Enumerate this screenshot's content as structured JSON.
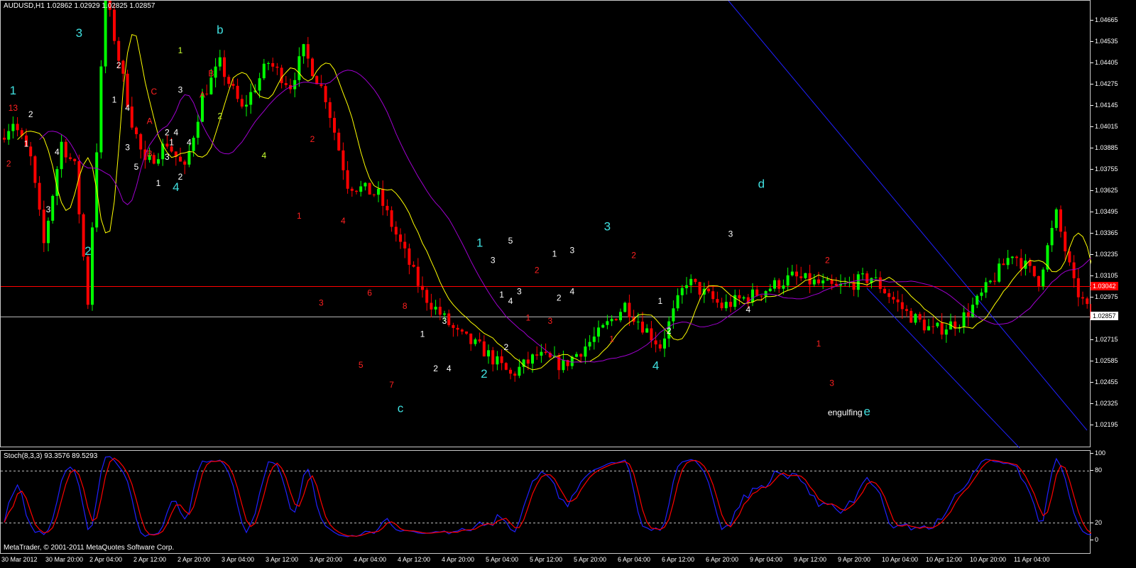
{
  "chart_header": "AUDUSD,H1  1.02862 1.02929 1.02825 1.02857",
  "stoch_header": "Stoch(8,3,3) 93.3576 89.5293",
  "copyright": "MetaTrader, © 2001-2011 MetaQuotes Software Corp.",
  "colors": {
    "bull": "#00ff00",
    "bear": "#ff0000",
    "fast_ma": "#ffff00",
    "slow_ma": "#a000d0",
    "channel": "#2020ff",
    "red_level": "#ff0000",
    "price_line": "#c0c0c0",
    "stoch_main": "#2020ff",
    "stoch_signal": "#ff0000"
  },
  "price_scale": [
    "1.04665",
    "1.04535",
    "1.04405",
    "1.04275",
    "1.04145",
    "1.04015",
    "1.03885",
    "1.03755",
    "1.03625",
    "1.03495",
    "1.03365",
    "1.03235",
    "1.03105",
    "1.02975",
    "1.02845",
    "1.02715",
    "1.02585",
    "1.02455",
    "1.02325",
    "1.02195"
  ],
  "badges": {
    "red_level_value": "1.03042",
    "current_price": "1.02857"
  },
  "stoch_scale": [
    "100",
    "80",
    "20",
    "0"
  ],
  "time_scale": [
    "30 Mar 2012",
    "30 Mar 20:00",
    "2 Apr 04:00",
    "2 Apr 12:00",
    "2 Apr 20:00",
    "3 Apr 04:00",
    "3 Apr 12:00",
    "3 Apr 20:00",
    "4 Apr 04:00",
    "4 Apr 12:00",
    "4 Apr 20:00",
    "5 Apr 04:00",
    "5 Apr 12:00",
    "5 Apr 20:00",
    "6 Apr 04:00",
    "6 Apr 12:00",
    "6 Apr 20:00",
    "9 Apr 04:00",
    "9 Apr 12:00",
    "9 Apr 20:00",
    "10 Apr 04:00",
    "10 Apr 12:00",
    "10 Apr 20:00",
    "11 Apr 04:00"
  ],
  "chart_data": {
    "type": "candlestick",
    "symbol": "AUDUSD",
    "timeframe": "H1",
    "ylim": [
      1.02195,
      1.04665
    ],
    "bar_count": 250,
    "levels": {
      "red_horizontal": 1.03042,
      "current_price": 1.02857
    },
    "waypoints": [
      [
        0,
        1.0395
      ],
      [
        3,
        1.0405
      ],
      [
        7,
        1.0382
      ],
      [
        10,
        1.033
      ],
      [
        14,
        1.0392
      ],
      [
        17,
        1.0377
      ],
      [
        20,
        1.0295
      ],
      [
        24,
        1.0482
      ],
      [
        30,
        1.0405
      ],
      [
        33,
        1.0378
      ],
      [
        38,
        1.0392
      ],
      [
        42,
        1.0375
      ],
      [
        46,
        1.042
      ],
      [
        50,
        1.044
      ],
      [
        55,
        1.0412
      ],
      [
        61,
        1.0441
      ],
      [
        66,
        1.0427
      ],
      [
        69,
        1.0448
      ],
      [
        74,
        1.042
      ],
      [
        79,
        1.0367
      ],
      [
        86,
        1.036
      ],
      [
        96,
        1.03
      ],
      [
        104,
        1.0275
      ],
      [
        110,
        1.0265
      ],
      [
        116,
        1.025
      ],
      [
        122,
        1.0262
      ],
      [
        128,
        1.0256
      ],
      [
        136,
        1.0275
      ],
      [
        142,
        1.0293
      ],
      [
        150,
        1.0268
      ],
      [
        156,
        1.0308
      ],
      [
        164,
        1.0292
      ],
      [
        172,
        1.03
      ],
      [
        180,
        1.031
      ],
      [
        190,
        1.0303
      ],
      [
        198,
        1.031
      ],
      [
        206,
        1.0288
      ],
      [
        212,
        1.0277
      ],
      [
        218,
        1.0283
      ],
      [
        222,
        1.0295
      ],
      [
        230,
        1.0325
      ],
      [
        236,
        1.0308
      ],
      [
        240,
        1.0348
      ],
      [
        244,
        1.0305
      ],
      [
        250,
        1.0275
      ]
    ],
    "price_labels": [
      {
        "text": "3",
        "t": "30 Mar 17:00",
        "price": 1.04565,
        "color": "cyan"
      },
      {
        "text": "b",
        "t": "3 Apr 01:00",
        "price": 1.04585,
        "color": "cyan"
      },
      {
        "text": "1",
        "t": "2 Apr 16:00",
        "price": 1.04465,
        "color": "yellow"
      },
      {
        "text": "1",
        "t": "30 Mar 02:00",
        "price": 1.04215,
        "color": "cyan"
      },
      {
        "text": "13",
        "t": "30 Mar 02:00",
        "price": 1.04115,
        "color": "red"
      },
      {
        "text": "2",
        "t": "30 Mar 06:00",
        "price": 1.04075,
        "color": "white"
      },
      {
        "text": "2",
        "t": "30 Mar 01:00",
        "price": 1.03775,
        "color": "red"
      },
      {
        "text": "1",
        "t": "30 Mar 05:00",
        "price": 1.03895,
        "color": "white"
      },
      {
        "text": "4",
        "t": "30 Mar 12:00",
        "price": 1.03845,
        "color": "white"
      },
      {
        "text": "3",
        "t": "30 Mar 10:00",
        "price": 1.03495,
        "color": "white"
      },
      {
        "text": "2",
        "t": "30 Mar 19:00",
        "price": 1.03235,
        "color": "cyan"
      },
      {
        "text": "2",
        "t": "2 Apr 02:00",
        "price": 1.04375,
        "color": "white"
      },
      {
        "text": "1",
        "t": "2 Apr 01:00",
        "price": 1.04165,
        "color": "white"
      },
      {
        "text": "4",
        "t": "2 Apr 04:00",
        "price": 1.04115,
        "color": "white"
      },
      {
        "text": "C",
        "t": "2 Apr 10:00",
        "price": 1.04215,
        "color": "red"
      },
      {
        "text": "A",
        "t": "2 Apr 09:00",
        "price": 1.04035,
        "color": "red"
      },
      {
        "text": "3",
        "t": "2 Apr 04:00",
        "price": 1.03875,
        "color": "white"
      },
      {
        "text": "B",
        "t": "2 Apr 09:00",
        "price": 1.03835,
        "color": "red"
      },
      {
        "text": "5",
        "t": "2 Apr 06:00",
        "price": 1.03755,
        "color": "white"
      },
      {
        "text": "3",
        "t": "2 Apr 16:00",
        "price": 1.04225,
        "color": "white"
      },
      {
        "text": "2",
        "t": "2 Apr 13:00",
        "price": 1.03965,
        "color": "white"
      },
      {
        "text": "4",
        "t": "2 Apr 15:00",
        "price": 1.03965,
        "color": "white"
      },
      {
        "text": "1",
        "t": "2 Apr 14:00",
        "price": 1.03905,
        "color": "white"
      },
      {
        "text": "4",
        "t": "2 Apr 18:00",
        "price": 1.03905,
        "color": "white"
      },
      {
        "text": "3",
        "t": "2 Apr 13:00",
        "price": 1.03815,
        "color": "white"
      },
      {
        "text": "2",
        "t": "2 Apr 16:00",
        "price": 1.03695,
        "color": "white"
      },
      {
        "text": "1",
        "t": "2 Apr 11:00",
        "price": 1.03655,
        "color": "white"
      },
      {
        "text": "4",
        "t": "2 Apr 15:00",
        "price": 1.03625,
        "color": "cyan"
      },
      {
        "text": "B",
        "t": "2 Apr 23:00",
        "price": 1.04325,
        "color": "red"
      },
      {
        "text": "A",
        "t": "2 Apr 21:00",
        "price": 1.04195,
        "color": "red"
      },
      {
        "text": "2",
        "t": "3 Apr 01:00",
        "price": 1.04065,
        "color": "yellow"
      },
      {
        "text": "4",
        "t": "3 Apr 11:00",
        "price": 1.03825,
        "color": "yellow"
      },
      {
        "text": "2",
        "t": "3 Apr 22:00",
        "price": 1.03925,
        "color": "red"
      },
      {
        "text": "1",
        "t": "3 Apr 19:00",
        "price": 1.03455,
        "color": "red"
      },
      {
        "text": "4",
        "t": "4 Apr 05:00",
        "price": 1.03425,
        "color": "red"
      },
      {
        "text": "3",
        "t": "4 Apr 00:00",
        "price": 1.02925,
        "color": "red"
      },
      {
        "text": "6",
        "t": "4 Apr 11:00",
        "price": 1.02985,
        "color": "red"
      },
      {
        "text": "5",
        "t": "4 Apr 09:00",
        "price": 1.02545,
        "color": "red"
      },
      {
        "text": "8",
        "t": "4 Apr 19:00",
        "price": 1.02905,
        "color": "red"
      },
      {
        "text": "7",
        "t": "4 Apr 16:00",
        "price": 1.02425,
        "color": "red"
      },
      {
        "text": "c",
        "t": "4 Apr 18:00",
        "price": 1.02275,
        "color": "cyan"
      },
      {
        "text": "1",
        "t": "4 Apr 23:00",
        "price": 1.02735,
        "color": "white"
      },
      {
        "text": "2",
        "t": "5 Apr 02:00",
        "price": 1.02525,
        "color": "white"
      },
      {
        "text": "3",
        "t": "5 Apr 04:00",
        "price": 1.02815,
        "color": "white"
      },
      {
        "text": "4",
        "t": "5 Apr 05:00",
        "price": 1.02525,
        "color": "white"
      },
      {
        "text": "1",
        "t": "5 Apr 12:00",
        "price": 1.03285,
        "color": "cyan"
      },
      {
        "text": "2",
        "t": "5 Apr 13:00",
        "price": 1.02485,
        "color": "cyan"
      },
      {
        "text": "3",
        "t": "5 Apr 15:00",
        "price": 1.03185,
        "color": "white"
      },
      {
        "text": "5",
        "t": "5 Apr 19:00",
        "price": 1.03305,
        "color": "white"
      },
      {
        "text": "1",
        "t": "5 Apr 17:00",
        "price": 1.02975,
        "color": "white"
      },
      {
        "text": "4",
        "t": "5 Apr 19:00",
        "price": 1.02935,
        "color": "white"
      },
      {
        "text": "2",
        "t": "5 Apr 18:00",
        "price": 1.02655,
        "color": "white"
      },
      {
        "text": "3",
        "t": "5 Apr 21:00",
        "price": 1.02995,
        "color": "white"
      },
      {
        "text": "2",
        "t": "6 Apr 01:00",
        "price": 1.03125,
        "color": "red"
      },
      {
        "text": "1",
        "t": "5 Apr 23:00",
        "price": 1.02835,
        "color": "red"
      },
      {
        "text": "3",
        "t": "6 Apr 04:00",
        "price": 1.02815,
        "color": "red"
      },
      {
        "text": "1",
        "t": "6 Apr 05:00",
        "price": 1.03225,
        "color": "white"
      },
      {
        "text": "3",
        "t": "6 Apr 09:00",
        "price": 1.03245,
        "color": "white"
      },
      {
        "text": "2",
        "t": "6 Apr 06:00",
        "price": 1.02955,
        "color": "white"
      },
      {
        "text": "4",
        "t": "6 Apr 09:00",
        "price": 1.02995,
        "color": "white"
      },
      {
        "text": "3",
        "t": "6 Apr 17:00",
        "price": 1.03385,
        "color": "cyan"
      },
      {
        "text": "1",
        "t": "6 Apr 18:00",
        "price": 1.02705,
        "color": "red"
      },
      {
        "text": "2",
        "t": "6 Apr 23:00",
        "price": 1.03215,
        "color": "red"
      },
      {
        "text": "1",
        "t": "9 Apr 05:00",
        "price": 1.02935,
        "color": "white"
      },
      {
        "text": "4",
        "t": "9 Apr 04:00",
        "price": 1.02535,
        "color": "cyan"
      },
      {
        "text": "2",
        "t": "9 Apr 07:00",
        "price": 1.02755,
        "color": "white"
      },
      {
        "text": "3",
        "t": "9 Apr 21:00",
        "price": 1.03345,
        "color": "white"
      },
      {
        "text": "4",
        "t": "10 Apr 01:00",
        "price": 1.02885,
        "color": "white"
      },
      {
        "text": "d",
        "t": "10 Apr 04:00",
        "price": 1.03645,
        "color": "cyan"
      },
      {
        "text": "2",
        "t": "10 Apr 19:00",
        "price": 1.03185,
        "color": "red"
      },
      {
        "text": "1",
        "t": "10 Apr 17:00",
        "price": 1.02675,
        "color": "red"
      },
      {
        "text": "3",
        "t": "10 Apr 20:00",
        "price": 1.02435,
        "color": "red"
      },
      {
        "text": "engulfing",
        "t": "10 Apr 23:00",
        "price": 1.02255,
        "color": "white"
      },
      {
        "text": "e",
        "t": "11 Apr 04:00",
        "price": 1.02255,
        "color": "cyan"
      }
    ],
    "stochastic": {
      "main_period": 8,
      "k_slow": 3,
      "d_period": 3,
      "main_last": 93.3576,
      "signal_last": 89.5293,
      "levels": [
        80,
        20
      ],
      "ylim": [
        0,
        100
      ]
    }
  }
}
